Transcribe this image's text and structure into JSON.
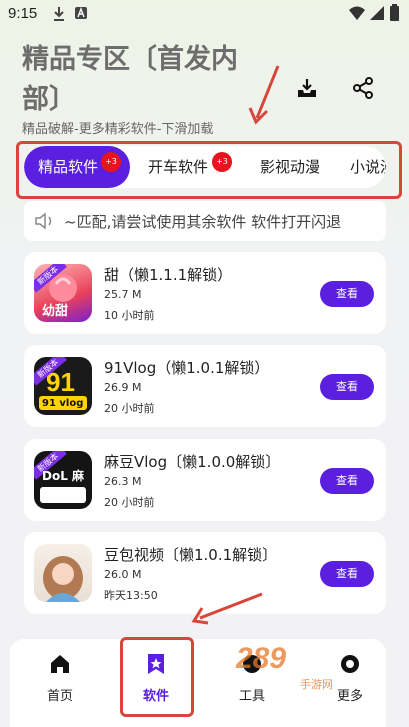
{
  "status_bar": {
    "time": "9:15"
  },
  "header": {
    "title": "精品专区〔首发内部〕",
    "subtitle": "精品破解-更多精彩软件-下滑加载"
  },
  "tabs": [
    {
      "label": "精品软件",
      "badge": "+3",
      "active": true
    },
    {
      "label": "开车软件",
      "badge": "+3",
      "active": false
    },
    {
      "label": "影视动漫",
      "active": false
    },
    {
      "label": "小说漫",
      "active": false
    }
  ],
  "notice": {
    "text": "~匹配,请尝试使用其余软件   软件打开闪退"
  },
  "apps": [
    {
      "name": "甜（懒1.1.1解锁）",
      "size": "25.7 M",
      "time": "10 小时前",
      "button": "查看",
      "icon_text": "幼甜",
      "tag": "新版本"
    },
    {
      "name": "91Vlog（懒1.0.1解锁）",
      "size": "26.9 M",
      "time": "20 小时前",
      "button": "查看",
      "icon_text": "91 vlog",
      "tag": "新版本"
    },
    {
      "name": "麻豆Vlog〔懒1.0.0解锁〕",
      "size": "26.3 M",
      "time": "20 小时前",
      "button": "查看",
      "icon_text": "DoL 麻豆",
      "tag": "新版本"
    },
    {
      "name": "豆包视频〔懒1.0.1解锁〕",
      "size": "26.0 M",
      "time": "昨天13:50",
      "button": "查看"
    }
  ],
  "bottom_nav": [
    {
      "label": "首页",
      "icon": "home-icon"
    },
    {
      "label": "软件",
      "icon": "star-bookmark-icon",
      "active": true
    },
    {
      "label": "工具",
      "icon": "tools-icon"
    },
    {
      "label": "更多",
      "icon": "more-icon"
    }
  ],
  "watermark": {
    "text": "289",
    "sub": "手游网"
  },
  "colors": {
    "accent": "#5b1fe0",
    "badge": "#e5141e",
    "annotation": "#d8453a"
  }
}
